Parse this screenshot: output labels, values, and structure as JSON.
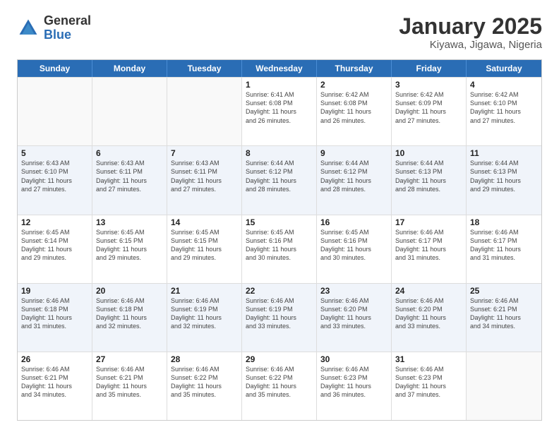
{
  "logo": {
    "general": "General",
    "blue": "Blue"
  },
  "title": "January 2025",
  "subtitle": "Kiyawa, Jigawa, Nigeria",
  "days_of_week": [
    "Sunday",
    "Monday",
    "Tuesday",
    "Wednesday",
    "Thursday",
    "Friday",
    "Saturday"
  ],
  "weeks": [
    [
      {
        "day": "",
        "info": ""
      },
      {
        "day": "",
        "info": ""
      },
      {
        "day": "",
        "info": ""
      },
      {
        "day": "1",
        "info": "Sunrise: 6:41 AM\nSunset: 6:08 PM\nDaylight: 11 hours\nand 26 minutes."
      },
      {
        "day": "2",
        "info": "Sunrise: 6:42 AM\nSunset: 6:08 PM\nDaylight: 11 hours\nand 26 minutes."
      },
      {
        "day": "3",
        "info": "Sunrise: 6:42 AM\nSunset: 6:09 PM\nDaylight: 11 hours\nand 27 minutes."
      },
      {
        "day": "4",
        "info": "Sunrise: 6:42 AM\nSunset: 6:10 PM\nDaylight: 11 hours\nand 27 minutes."
      }
    ],
    [
      {
        "day": "5",
        "info": "Sunrise: 6:43 AM\nSunset: 6:10 PM\nDaylight: 11 hours\nand 27 minutes."
      },
      {
        "day": "6",
        "info": "Sunrise: 6:43 AM\nSunset: 6:11 PM\nDaylight: 11 hours\nand 27 minutes."
      },
      {
        "day": "7",
        "info": "Sunrise: 6:43 AM\nSunset: 6:11 PM\nDaylight: 11 hours\nand 27 minutes."
      },
      {
        "day": "8",
        "info": "Sunrise: 6:44 AM\nSunset: 6:12 PM\nDaylight: 11 hours\nand 28 minutes."
      },
      {
        "day": "9",
        "info": "Sunrise: 6:44 AM\nSunset: 6:12 PM\nDaylight: 11 hours\nand 28 minutes."
      },
      {
        "day": "10",
        "info": "Sunrise: 6:44 AM\nSunset: 6:13 PM\nDaylight: 11 hours\nand 28 minutes."
      },
      {
        "day": "11",
        "info": "Sunrise: 6:44 AM\nSunset: 6:13 PM\nDaylight: 11 hours\nand 29 minutes."
      }
    ],
    [
      {
        "day": "12",
        "info": "Sunrise: 6:45 AM\nSunset: 6:14 PM\nDaylight: 11 hours\nand 29 minutes."
      },
      {
        "day": "13",
        "info": "Sunrise: 6:45 AM\nSunset: 6:15 PM\nDaylight: 11 hours\nand 29 minutes."
      },
      {
        "day": "14",
        "info": "Sunrise: 6:45 AM\nSunset: 6:15 PM\nDaylight: 11 hours\nand 29 minutes."
      },
      {
        "day": "15",
        "info": "Sunrise: 6:45 AM\nSunset: 6:16 PM\nDaylight: 11 hours\nand 30 minutes."
      },
      {
        "day": "16",
        "info": "Sunrise: 6:45 AM\nSunset: 6:16 PM\nDaylight: 11 hours\nand 30 minutes."
      },
      {
        "day": "17",
        "info": "Sunrise: 6:46 AM\nSunset: 6:17 PM\nDaylight: 11 hours\nand 31 minutes."
      },
      {
        "day": "18",
        "info": "Sunrise: 6:46 AM\nSunset: 6:17 PM\nDaylight: 11 hours\nand 31 minutes."
      }
    ],
    [
      {
        "day": "19",
        "info": "Sunrise: 6:46 AM\nSunset: 6:18 PM\nDaylight: 11 hours\nand 31 minutes."
      },
      {
        "day": "20",
        "info": "Sunrise: 6:46 AM\nSunset: 6:18 PM\nDaylight: 11 hours\nand 32 minutes."
      },
      {
        "day": "21",
        "info": "Sunrise: 6:46 AM\nSunset: 6:19 PM\nDaylight: 11 hours\nand 32 minutes."
      },
      {
        "day": "22",
        "info": "Sunrise: 6:46 AM\nSunset: 6:19 PM\nDaylight: 11 hours\nand 33 minutes."
      },
      {
        "day": "23",
        "info": "Sunrise: 6:46 AM\nSunset: 6:20 PM\nDaylight: 11 hours\nand 33 minutes."
      },
      {
        "day": "24",
        "info": "Sunrise: 6:46 AM\nSunset: 6:20 PM\nDaylight: 11 hours\nand 33 minutes."
      },
      {
        "day": "25",
        "info": "Sunrise: 6:46 AM\nSunset: 6:21 PM\nDaylight: 11 hours\nand 34 minutes."
      }
    ],
    [
      {
        "day": "26",
        "info": "Sunrise: 6:46 AM\nSunset: 6:21 PM\nDaylight: 11 hours\nand 34 minutes."
      },
      {
        "day": "27",
        "info": "Sunrise: 6:46 AM\nSunset: 6:21 PM\nDaylight: 11 hours\nand 35 minutes."
      },
      {
        "day": "28",
        "info": "Sunrise: 6:46 AM\nSunset: 6:22 PM\nDaylight: 11 hours\nand 35 minutes."
      },
      {
        "day": "29",
        "info": "Sunrise: 6:46 AM\nSunset: 6:22 PM\nDaylight: 11 hours\nand 35 minutes."
      },
      {
        "day": "30",
        "info": "Sunrise: 6:46 AM\nSunset: 6:23 PM\nDaylight: 11 hours\nand 36 minutes."
      },
      {
        "day": "31",
        "info": "Sunrise: 6:46 AM\nSunset: 6:23 PM\nDaylight: 11 hours\nand 37 minutes."
      },
      {
        "day": "",
        "info": ""
      }
    ]
  ]
}
